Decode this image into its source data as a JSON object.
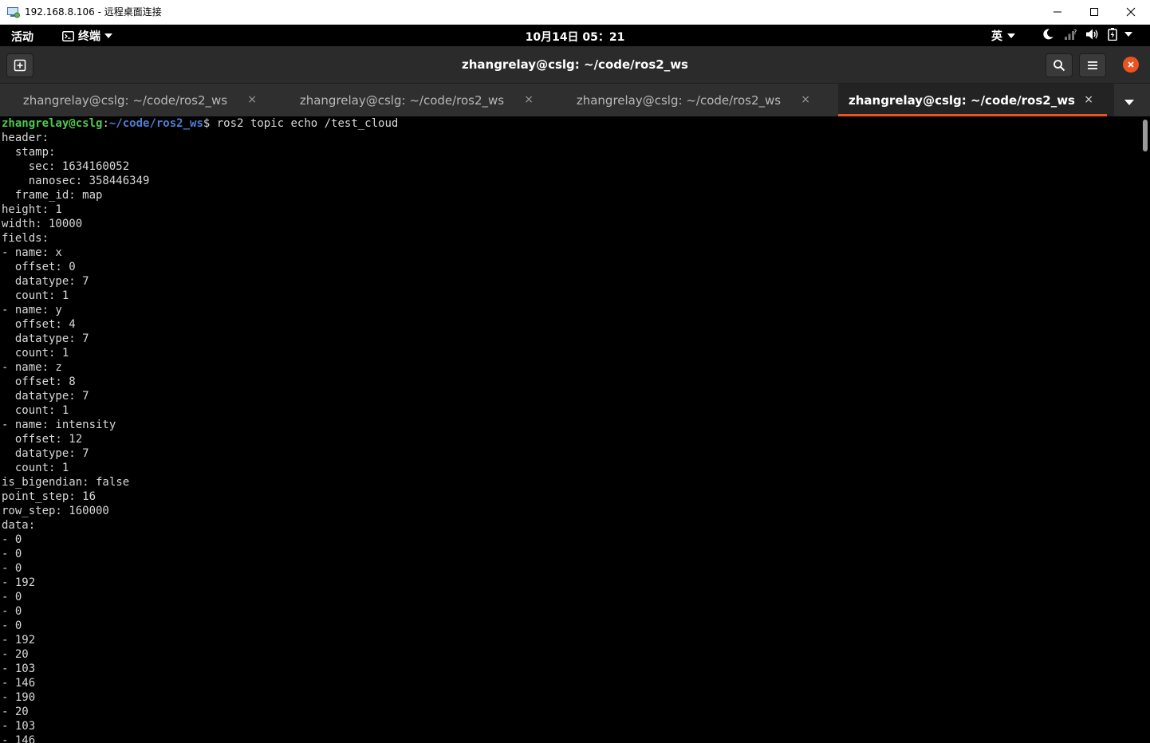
{
  "window": {
    "title": "192.168.8.106 - 远程桌面连接",
    "minimize": "—",
    "maximize": "☐",
    "close": "✕"
  },
  "topbar": {
    "activities": "活动",
    "app_menu": "终端",
    "clock": "10月14日 05：21",
    "input_method": "英"
  },
  "headerbar": {
    "title": "zhangrelay@cslg: ~/code/ros2_ws"
  },
  "tabs": [
    {
      "label": "zhangrelay@cslg: ~/code/ros2_ws",
      "close": "×",
      "active": false
    },
    {
      "label": "zhangrelay@cslg: ~/code/ros2_ws",
      "close": "×",
      "active": false
    },
    {
      "label": "zhangrelay@cslg: ~/code/ros2_ws",
      "close": "×",
      "active": false
    },
    {
      "label": "zhangrelay@cslg: ~/code/ros2_ws",
      "close": "×",
      "active": true
    }
  ],
  "terminal": {
    "prompt_user": "zhangrelay@cslg",
    "prompt_colon": ":",
    "prompt_path": "~/code/ros2_ws",
    "prompt_dollar": "$ ",
    "command": "ros2 topic echo /test_cloud",
    "lines": [
      "header:",
      "  stamp:",
      "    sec: 1634160052",
      "    nanosec: 358446349",
      "  frame_id: map",
      "height: 1",
      "width: 10000",
      "fields:",
      "- name: x",
      "  offset: 0",
      "  datatype: 7",
      "  count: 1",
      "- name: y",
      "  offset: 4",
      "  datatype: 7",
      "  count: 1",
      "- name: z",
      "  offset: 8",
      "  datatype: 7",
      "  count: 1",
      "- name: intensity",
      "  offset: 12",
      "  datatype: 7",
      "  count: 1",
      "is_bigendian: false",
      "point_step: 16",
      "row_step: 160000",
      "data:",
      "- 0",
      "- 0",
      "- 0",
      "- 192",
      "- 0",
      "- 0",
      "- 0",
      "- 192",
      "- 20",
      "- 103",
      "- 146",
      "- 190",
      "- 20",
      "- 103",
      "- 146"
    ]
  },
  "colors": {
    "accent": "#e95420",
    "prompt_user": "#4ec94e",
    "prompt_path": "#4c7fd6"
  }
}
